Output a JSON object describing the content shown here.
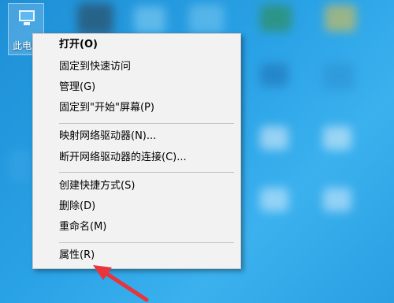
{
  "desktop": {
    "icon_label": "此电脑"
  },
  "context_menu": {
    "items": [
      {
        "label": "打开(O)",
        "bold": true
      },
      {
        "label": "固定到快速访问"
      },
      {
        "label": "管理(G)"
      },
      {
        "label": "固定到\"开始\"屏幕(P)"
      },
      {
        "label": "映射网络驱动器(N)..."
      },
      {
        "label": "断开网络驱动器的连接(C)..."
      },
      {
        "label": "创建快捷方式(S)"
      },
      {
        "label": "删除(D)"
      },
      {
        "label": "重命名(M)"
      },
      {
        "label": "属性(R)"
      }
    ]
  },
  "colors": {
    "desktop_background": "#2aa2e6",
    "menu_background": "#f2f2f2",
    "annotation_arrow": "#e8343a"
  },
  "icons": {
    "desktop_icon": "computer-icon",
    "annotation": "red-arrow-icon"
  }
}
